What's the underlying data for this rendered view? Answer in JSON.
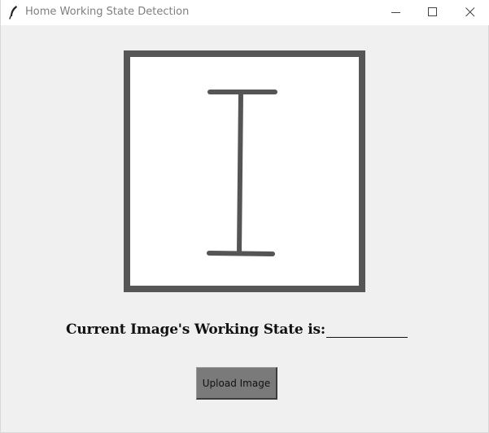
{
  "window": {
    "title": "Home Working State Detection",
    "app_icon": "feather-icon",
    "controls": {
      "minimize_icon": "minimize-icon",
      "maximize_icon": "maximize-icon",
      "close_icon": "close-icon"
    }
  },
  "main": {
    "image_preview": {
      "glyph": "I-beam-cursor-icon"
    },
    "state_label": "Current Image's Working State is:",
    "state_value": "",
    "upload_button_label": "Upload Image"
  },
  "colors": {
    "window_background": "#f0f0f0",
    "titlebar_background": "#ffffff",
    "frame_border": "#565656",
    "button_background": "#7a7a7a",
    "text": "#111111"
  }
}
